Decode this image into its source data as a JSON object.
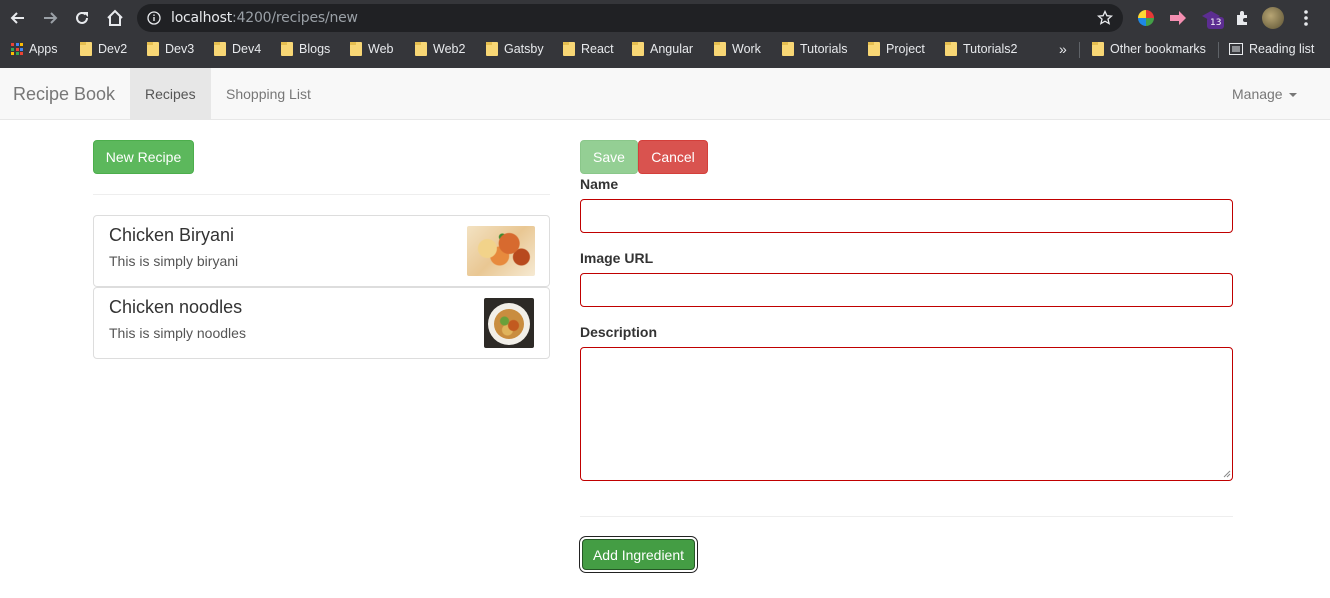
{
  "browser": {
    "url_host": "localhost",
    "url_path": ":4200/recipes/new",
    "extension_badge": "13",
    "bookmarks": [
      "Apps",
      "Dev2",
      "Dev3",
      "Dev4",
      "Blogs",
      "Web",
      "Web2",
      "Gatsby",
      "React",
      "Angular",
      "Work",
      "Tutorials",
      "Project",
      "Tutorials2"
    ],
    "overflow_label": "»",
    "other_bookmarks": "Other bookmarks",
    "reading_list": "Reading list"
  },
  "navbar": {
    "brand": "Recipe Book",
    "items": [
      "Recipes",
      "Shopping List"
    ],
    "active_item": "Recipes",
    "manage": "Manage"
  },
  "recipes": {
    "new_button": "New Recipe",
    "list": [
      {
        "name": "Chicken Biryani",
        "description": "This is simply biryani"
      },
      {
        "name": "Chicken noodles",
        "description": "This is simply noodles"
      }
    ]
  },
  "form": {
    "save_button": "Save",
    "cancel_button": "Cancel",
    "name_label": "Name",
    "name_value": "",
    "image_label": "Image URL",
    "image_value": "",
    "description_label": "Description",
    "description_value": "",
    "add_ingredient_button": "Add Ingredient"
  },
  "colors": {
    "success": "#5cb85c",
    "danger": "#d9534f",
    "invalid_border": "#c00000",
    "chrome_dark": "#35363a"
  }
}
